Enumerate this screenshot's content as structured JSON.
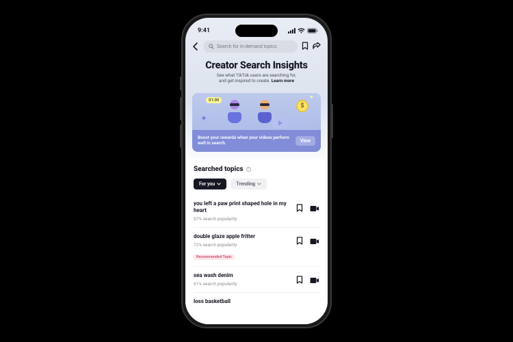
{
  "status": {
    "time": "9:41"
  },
  "search": {
    "placeholder": "Search for in-demand topics"
  },
  "hero": {
    "title": "Creator Search Insights",
    "subtitle_line1": "See what TikTok users are searching for,",
    "subtitle_line2_prefix": "and get inspired to create. ",
    "learn_more": "Learn more"
  },
  "promo": {
    "timer": "01:00",
    "coin_symbol": "$",
    "text": "Boost your rewards when your videos perform well in search.",
    "cta": "View"
  },
  "section": {
    "title": "Searched topics",
    "tabs": {
      "for_you": "For you",
      "trending": "Trending"
    }
  },
  "topics": [
    {
      "title": "you left a paw print shaped hole in my heart",
      "popularity": "57% search popularity",
      "badge": ""
    },
    {
      "title": "double glaze apple fritter",
      "popularity": "72% search popularity",
      "badge": "Recommended Topic"
    },
    {
      "title": "sea wash denim",
      "popularity": "61% search popularity",
      "badge": ""
    },
    {
      "title": "loss basketball",
      "popularity": "",
      "badge": ""
    }
  ]
}
